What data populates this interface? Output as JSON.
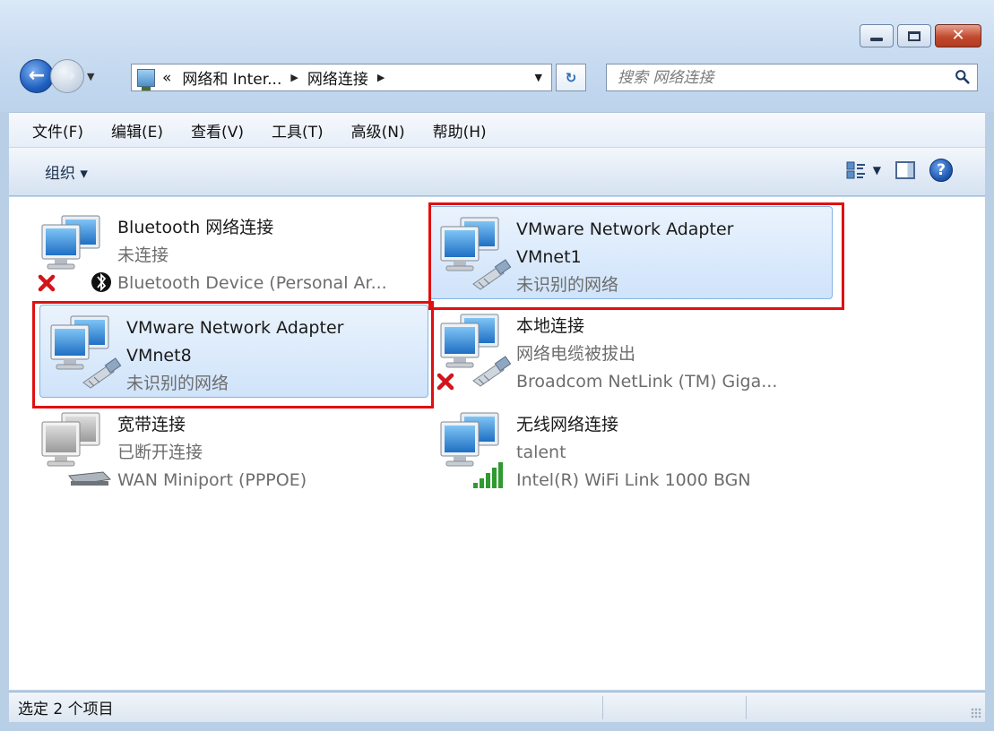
{
  "window": {
    "caption": {
      "minimize": "–",
      "maximize": "□",
      "close": "✕"
    }
  },
  "address": {
    "prefix": "«",
    "crumbs": [
      "网络和 Inter...",
      "网络连接"
    ],
    "search_placeholder": "搜索 网络连接"
  },
  "menu": [
    "文件(F)",
    "编辑(E)",
    "查看(V)",
    "工具(T)",
    "高级(N)",
    "帮助(H)"
  ],
  "commandbar": {
    "organize": "组织 ▾",
    "help": "?"
  },
  "connections": [
    {
      "name": "Bluetooth 网络连接",
      "status": "未连接",
      "device": "Bluetooth Device (Personal Ar...",
      "icon": "bluetooth-network-icon",
      "selected": false,
      "badge": "bluetooth-disconnected"
    },
    {
      "name": "VMware Network Adapter",
      "name2": "VMnet1",
      "status": "未识别的网络",
      "icon": "ethernet-adapter-icon",
      "selected": true
    },
    {
      "name": "VMware Network Adapter",
      "name2": "VMnet8",
      "status": "未识别的网络",
      "icon": "ethernet-adapter-icon",
      "selected": true
    },
    {
      "name": "本地连接",
      "status": "网络电缆被拔出",
      "device": "Broadcom NetLink (TM) Giga...",
      "icon": "ethernet-adapter-icon",
      "selected": false,
      "badge": "cable-unplugged"
    },
    {
      "name": "宽带连接",
      "status": "已断开连接",
      "device": "WAN Miniport (PPPOE)",
      "icon": "broadband-modem-icon",
      "selected": false
    },
    {
      "name": "无线网络连接",
      "status": "talent",
      "device": "Intel(R) WiFi Link 1000 BGN",
      "icon": "wireless-signal-icon",
      "selected": false
    }
  ],
  "status": {
    "text": "选定 2 个项目"
  },
  "colors": {
    "highlight_box": "#e01010",
    "selection": "#cfe3fa",
    "frame": "#b8cfe6"
  }
}
